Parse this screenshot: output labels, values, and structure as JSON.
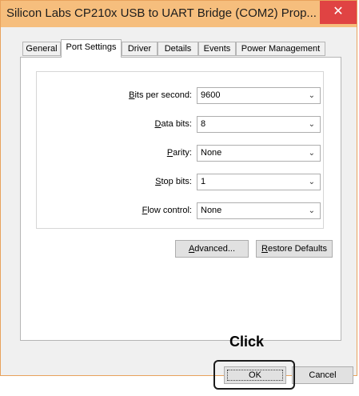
{
  "window": {
    "title": "Silicon Labs CP210x USB to UART Bridge (COM2) Prop...",
    "close_glyph": "✕"
  },
  "tabs": [
    {
      "label": "General",
      "active": false
    },
    {
      "label": "Port Settings",
      "active": true
    },
    {
      "label": "Driver",
      "active": false
    },
    {
      "label": "Details",
      "active": false
    },
    {
      "label": "Events",
      "active": false
    },
    {
      "label": "Power Management",
      "active": false
    }
  ],
  "settings": [
    {
      "mnemonic": "B",
      "rest": "its per second:",
      "value": "9600"
    },
    {
      "mnemonic": "D",
      "rest": "ata bits:",
      "value": "8"
    },
    {
      "mnemonic": "P",
      "rest": "arity:",
      "value": "None"
    },
    {
      "mnemonic": "S",
      "rest": "top bits:",
      "value": "1"
    },
    {
      "mnemonic": "F",
      "rest": "low control:",
      "value": "None"
    }
  ],
  "buttons": {
    "advanced": {
      "mnemonic": "A",
      "rest": "dvanced..."
    },
    "restore": {
      "mnemonic": "R",
      "rest": "estore Defaults"
    },
    "ok": "OK",
    "cancel": "Cancel"
  },
  "annotation": {
    "text": "Click"
  },
  "icons": {
    "dropdown": "chevron-down-icon",
    "close": "close-icon"
  },
  "colors": {
    "titlebar": "#f6be7d",
    "close": "#e04343",
    "window_border": "#e8a25c"
  }
}
